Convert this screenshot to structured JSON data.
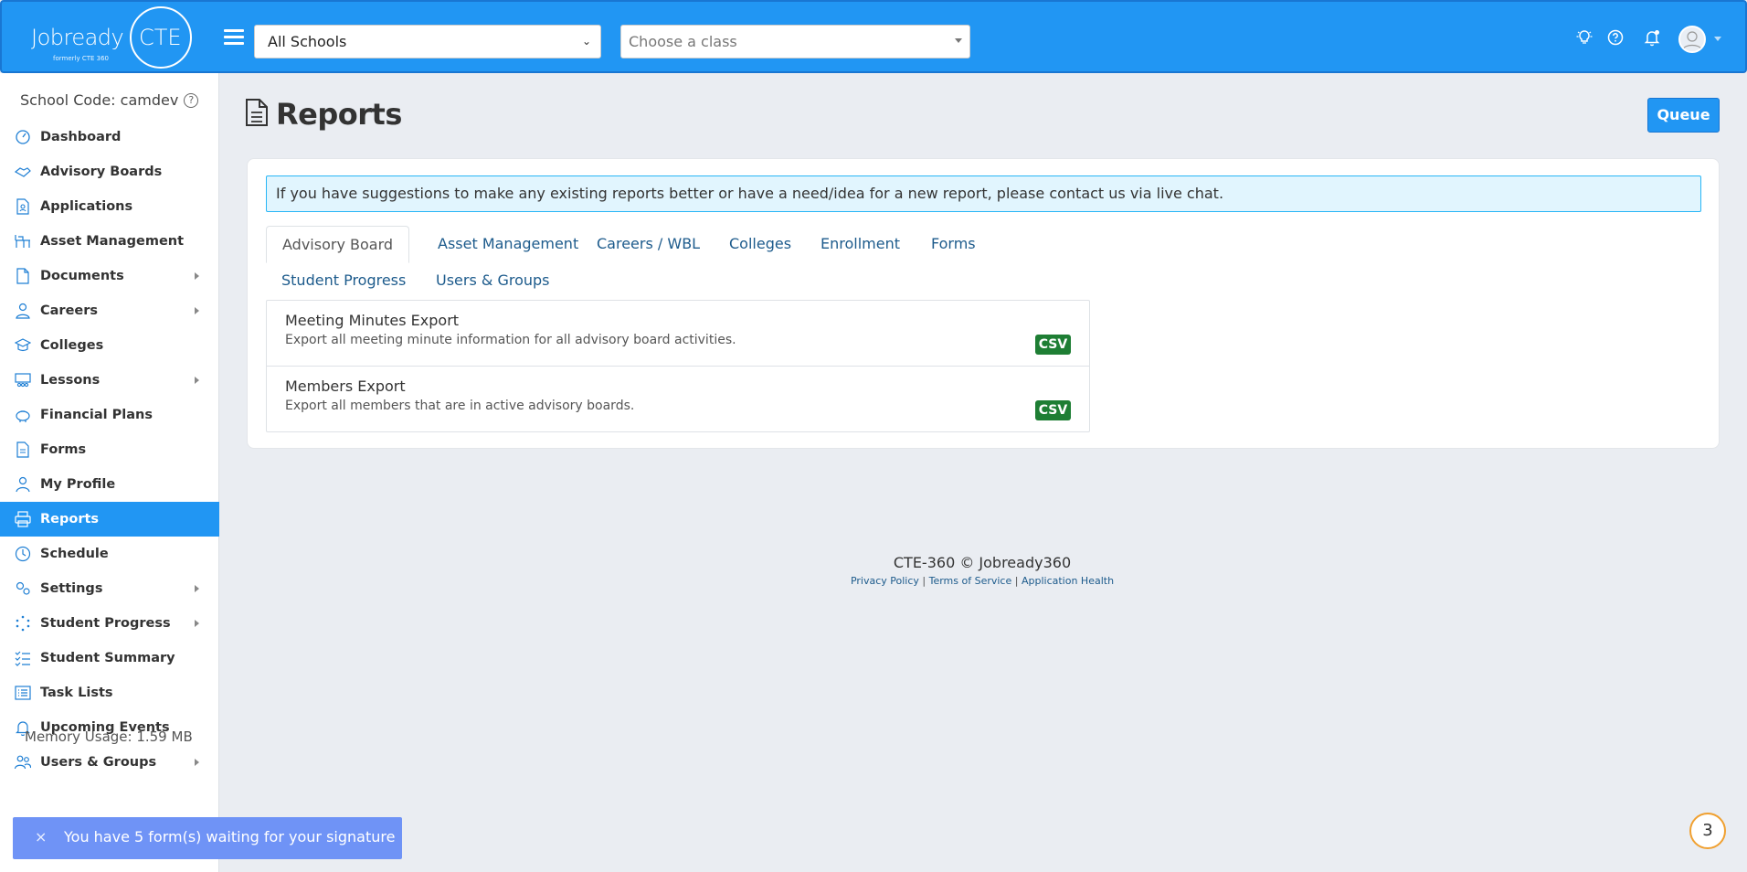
{
  "header": {
    "logo_main": "Jobready",
    "logo_cte": "CTE",
    "logo_sub": "formerly CTE 360",
    "school_select": "All Schools",
    "class_select_placeholder": "Choose a class"
  },
  "sidebar": {
    "school_code": "School Code: camdev",
    "items": [
      {
        "label": "Dashboard",
        "icon": "gauge-icon",
        "submenu": false
      },
      {
        "label": "Advisory Boards",
        "icon": "handshake-icon",
        "submenu": false
      },
      {
        "label": "Applications",
        "icon": "file-person-icon",
        "submenu": false
      },
      {
        "label": "Asset Management",
        "icon": "desk-icon",
        "submenu": false
      },
      {
        "label": "Documents",
        "icon": "document-icon",
        "submenu": true
      },
      {
        "label": "Careers",
        "icon": "user-tie-icon",
        "submenu": true
      },
      {
        "label": "Colleges",
        "icon": "graduation-cap-icon",
        "submenu": false
      },
      {
        "label": "Lessons",
        "icon": "classroom-icon",
        "submenu": true
      },
      {
        "label": "Financial Plans",
        "icon": "piggy-bank-icon",
        "submenu": false
      },
      {
        "label": "Forms",
        "icon": "form-icon",
        "submenu": false
      },
      {
        "label": "My Profile",
        "icon": "user-icon",
        "submenu": false
      },
      {
        "label": "Reports",
        "icon": "printer-icon",
        "submenu": false,
        "active": true
      },
      {
        "label": "Schedule",
        "icon": "clock-icon",
        "submenu": false
      },
      {
        "label": "Settings",
        "icon": "gears-icon",
        "submenu": true
      },
      {
        "label": "Student Progress",
        "icon": "spinner-icon",
        "submenu": true
      },
      {
        "label": "Student Summary",
        "icon": "checklist-icon",
        "submenu": false
      },
      {
        "label": "Task Lists",
        "icon": "list-icon",
        "submenu": false
      },
      {
        "label": "Upcoming Events",
        "icon": "bell-icon",
        "submenu": false
      },
      {
        "label": "Users & Groups",
        "icon": "users-icon",
        "submenu": true
      }
    ],
    "memory_usage": "Memory Usage: 1.59 MB"
  },
  "main": {
    "title": "Reports",
    "queue_label": "Queue",
    "alert": "If you have suggestions to make any existing reports better or have a need/idea for a new report, please contact us via live chat.",
    "tabs": [
      "Advisory Board",
      "Asset Management",
      "Careers / WBL",
      "Colleges",
      "Enrollment",
      "Forms",
      "Student Progress",
      "Users & Groups"
    ],
    "reports": [
      {
        "title": "Meeting Minutes Export",
        "description": "Export all meeting minute information for all advisory board activities.",
        "format": "CSV"
      },
      {
        "title": "Members Export",
        "description": "Export all members that are in active advisory boards.",
        "format": "CSV"
      }
    ]
  },
  "footer": {
    "copyright": "CTE-360 © Jobready360",
    "privacy": "Privacy Policy",
    "terms": "Terms of Service",
    "health": "Application Health",
    "separator": " | "
  },
  "toast": {
    "close": "×",
    "message": "You have 5 form(s) waiting for your signature"
  },
  "chat_badge": "3",
  "colors": {
    "primary": "#2196f3",
    "csv_badge": "#1e7e34",
    "alert_bg": "#e1f5fe",
    "toast_bg": "#6f93f6"
  }
}
